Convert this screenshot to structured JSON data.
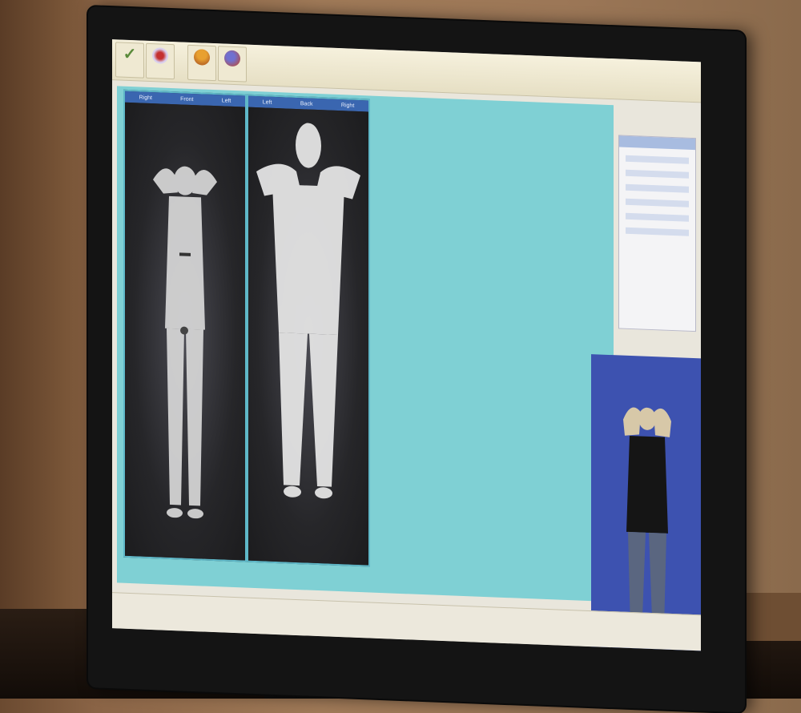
{
  "toolbar": {
    "buttons": [
      {
        "icon": "check-icon",
        "label": ""
      },
      {
        "icon": "crest-icon",
        "label": ""
      },
      {
        "icon": "pawn-icon",
        "label": ""
      },
      {
        "icon": "globe-icon",
        "label": ""
      }
    ]
  },
  "scans": [
    {
      "header": [
        "Right",
        "Front",
        "Left"
      ]
    },
    {
      "header": [
        "Left",
        "Back",
        "Right"
      ]
    }
  ],
  "colors": {
    "screen_teal": "#7fd0d4",
    "header_blue": "#3a66b0",
    "avatar_blue": "#3d52b0",
    "bezel": "#141414"
  }
}
